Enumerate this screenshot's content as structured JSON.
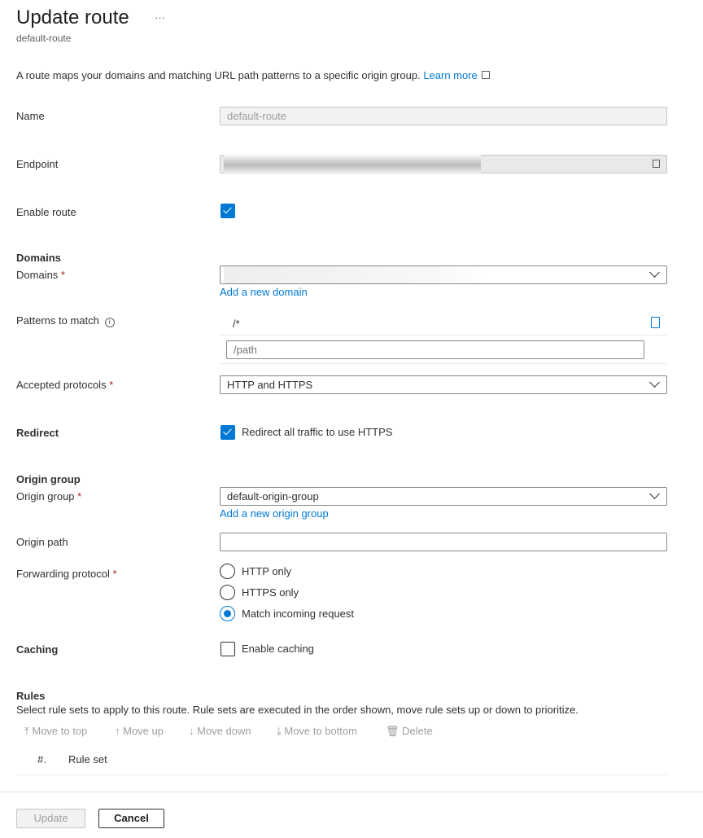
{
  "header": {
    "title": "Update route",
    "more": "···",
    "subtitle": "default-route"
  },
  "intro": {
    "text": "A route maps your domains and matching URL path patterns to a specific origin group.",
    "learn_more": "Learn more"
  },
  "form": {
    "name": {
      "label": "Name",
      "value": "default-route"
    },
    "endpoint": {
      "label": "Endpoint",
      "value": ""
    },
    "enable_route": {
      "label": "Enable route",
      "checked": true
    },
    "domains_heading": "Domains",
    "domains": {
      "label": "Domains",
      "required": "*",
      "add_link": "Add a new domain"
    },
    "patterns": {
      "label": "Patterns to match",
      "items": [
        "/*"
      ],
      "placeholder": "/path"
    },
    "accepted_protocols": {
      "label": "Accepted protocols",
      "required": "*",
      "value": "HTTP and HTTPS"
    },
    "redirect": {
      "label": "Redirect",
      "checkbox_label": "Redirect all traffic to use HTTPS",
      "checked": true
    },
    "origin_group_heading": "Origin group",
    "origin_group": {
      "label": "Origin group",
      "required": "*",
      "value": "default-origin-group",
      "add_link": "Add a new origin group"
    },
    "origin_path": {
      "label": "Origin path",
      "value": ""
    },
    "forwarding_protocol": {
      "label": "Forwarding protocol",
      "required": "*",
      "options": [
        "HTTP only",
        "HTTPS only",
        "Match incoming request"
      ],
      "selected": "Match incoming request"
    },
    "caching": {
      "label": "Caching",
      "checkbox_label": "Enable caching",
      "checked": false
    }
  },
  "rules": {
    "heading": "Rules",
    "description": "Select rule sets to apply to this route. Rule sets are executed in the order shown, move rule sets up or down to prioritize.",
    "toolbar": [
      "Move to top",
      "Move up",
      "Move down",
      "Move to bottom",
      "Delete"
    ],
    "columns": [
      "#.",
      "Rule set"
    ]
  },
  "footer": {
    "update": "Update",
    "cancel": "Cancel"
  },
  "colors": {
    "accent": "#0078d4",
    "required": "#a4262c"
  }
}
